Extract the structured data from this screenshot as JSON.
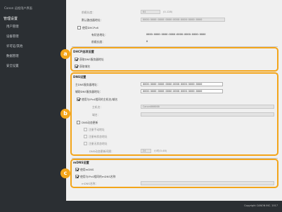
{
  "sidebar": {
    "title": "Canon 远程用户界面",
    "heading": "管理设置",
    "items": [
      "用户管理",
      "设备管理",
      "许可证/其他",
      "数据管理",
      "安全设置"
    ]
  },
  "ipv6": {
    "prefix_length_label": "前缀长度：",
    "prefix_length_value": "64",
    "prefix_length_range": "(0-128)",
    "default_gateway_label": "默认路由器地址：",
    "default_gateway_value": "0000:0000:0000:0000:0000:0000:0000:0000",
    "use_dhcpv6_label": "使用DHCPv6",
    "stateful_address_label": "有状态地址：",
    "stateful_address_value": "0000:0000:0000:0000:0000:0000:0000:0000",
    "stateful_prefix_label": "前缀长度：",
    "stateful_prefix_value": "0"
  },
  "dhcp_options": {
    "title": "DHCP选项设置",
    "get_dns_server_label": "获取DNS服务器地址",
    "get_domain_name_label": "获取域名",
    "badge": "a"
  },
  "dns": {
    "title": "DNS设置",
    "primary_label": "主DNS服务器地址：",
    "primary_value": "0000:0000:0000:0000:0000:0000:0000:0000",
    "secondary_label": "辅助DNS服务器地址：",
    "secondary_value": "0000:0000:0000:0000:0000:0000:0000:0000",
    "same_as_ipv4_label": "使用与IPv4相同的主机名/域名",
    "host_name_label": "主机名：",
    "host_name_value": "Canon000000",
    "domain_name_label": "域名：",
    "domain_name_value": "",
    "dynamic_update_label": "DNS动态更新",
    "register_manual_label": "注册手动地址",
    "register_stateful_label": "注册有状态地址",
    "register_stateless_label": "注册无状态地址",
    "update_interval_label": "DNS动态更新间隔：",
    "update_interval_value": "24",
    "update_interval_unit": "小时(0-48)",
    "badge": "b"
  },
  "mdns": {
    "title": "mDNS设置",
    "use_mdns_label": "使用mDNS",
    "same_name_as_ipv4_label": "使用与IPv4相同的mDNS名称",
    "mdns_name_label": "mDNS名称：",
    "mdns_name_value": "",
    "badge": "c"
  },
  "footer": {
    "copyright": "Copyright CANON INC. 2017"
  }
}
